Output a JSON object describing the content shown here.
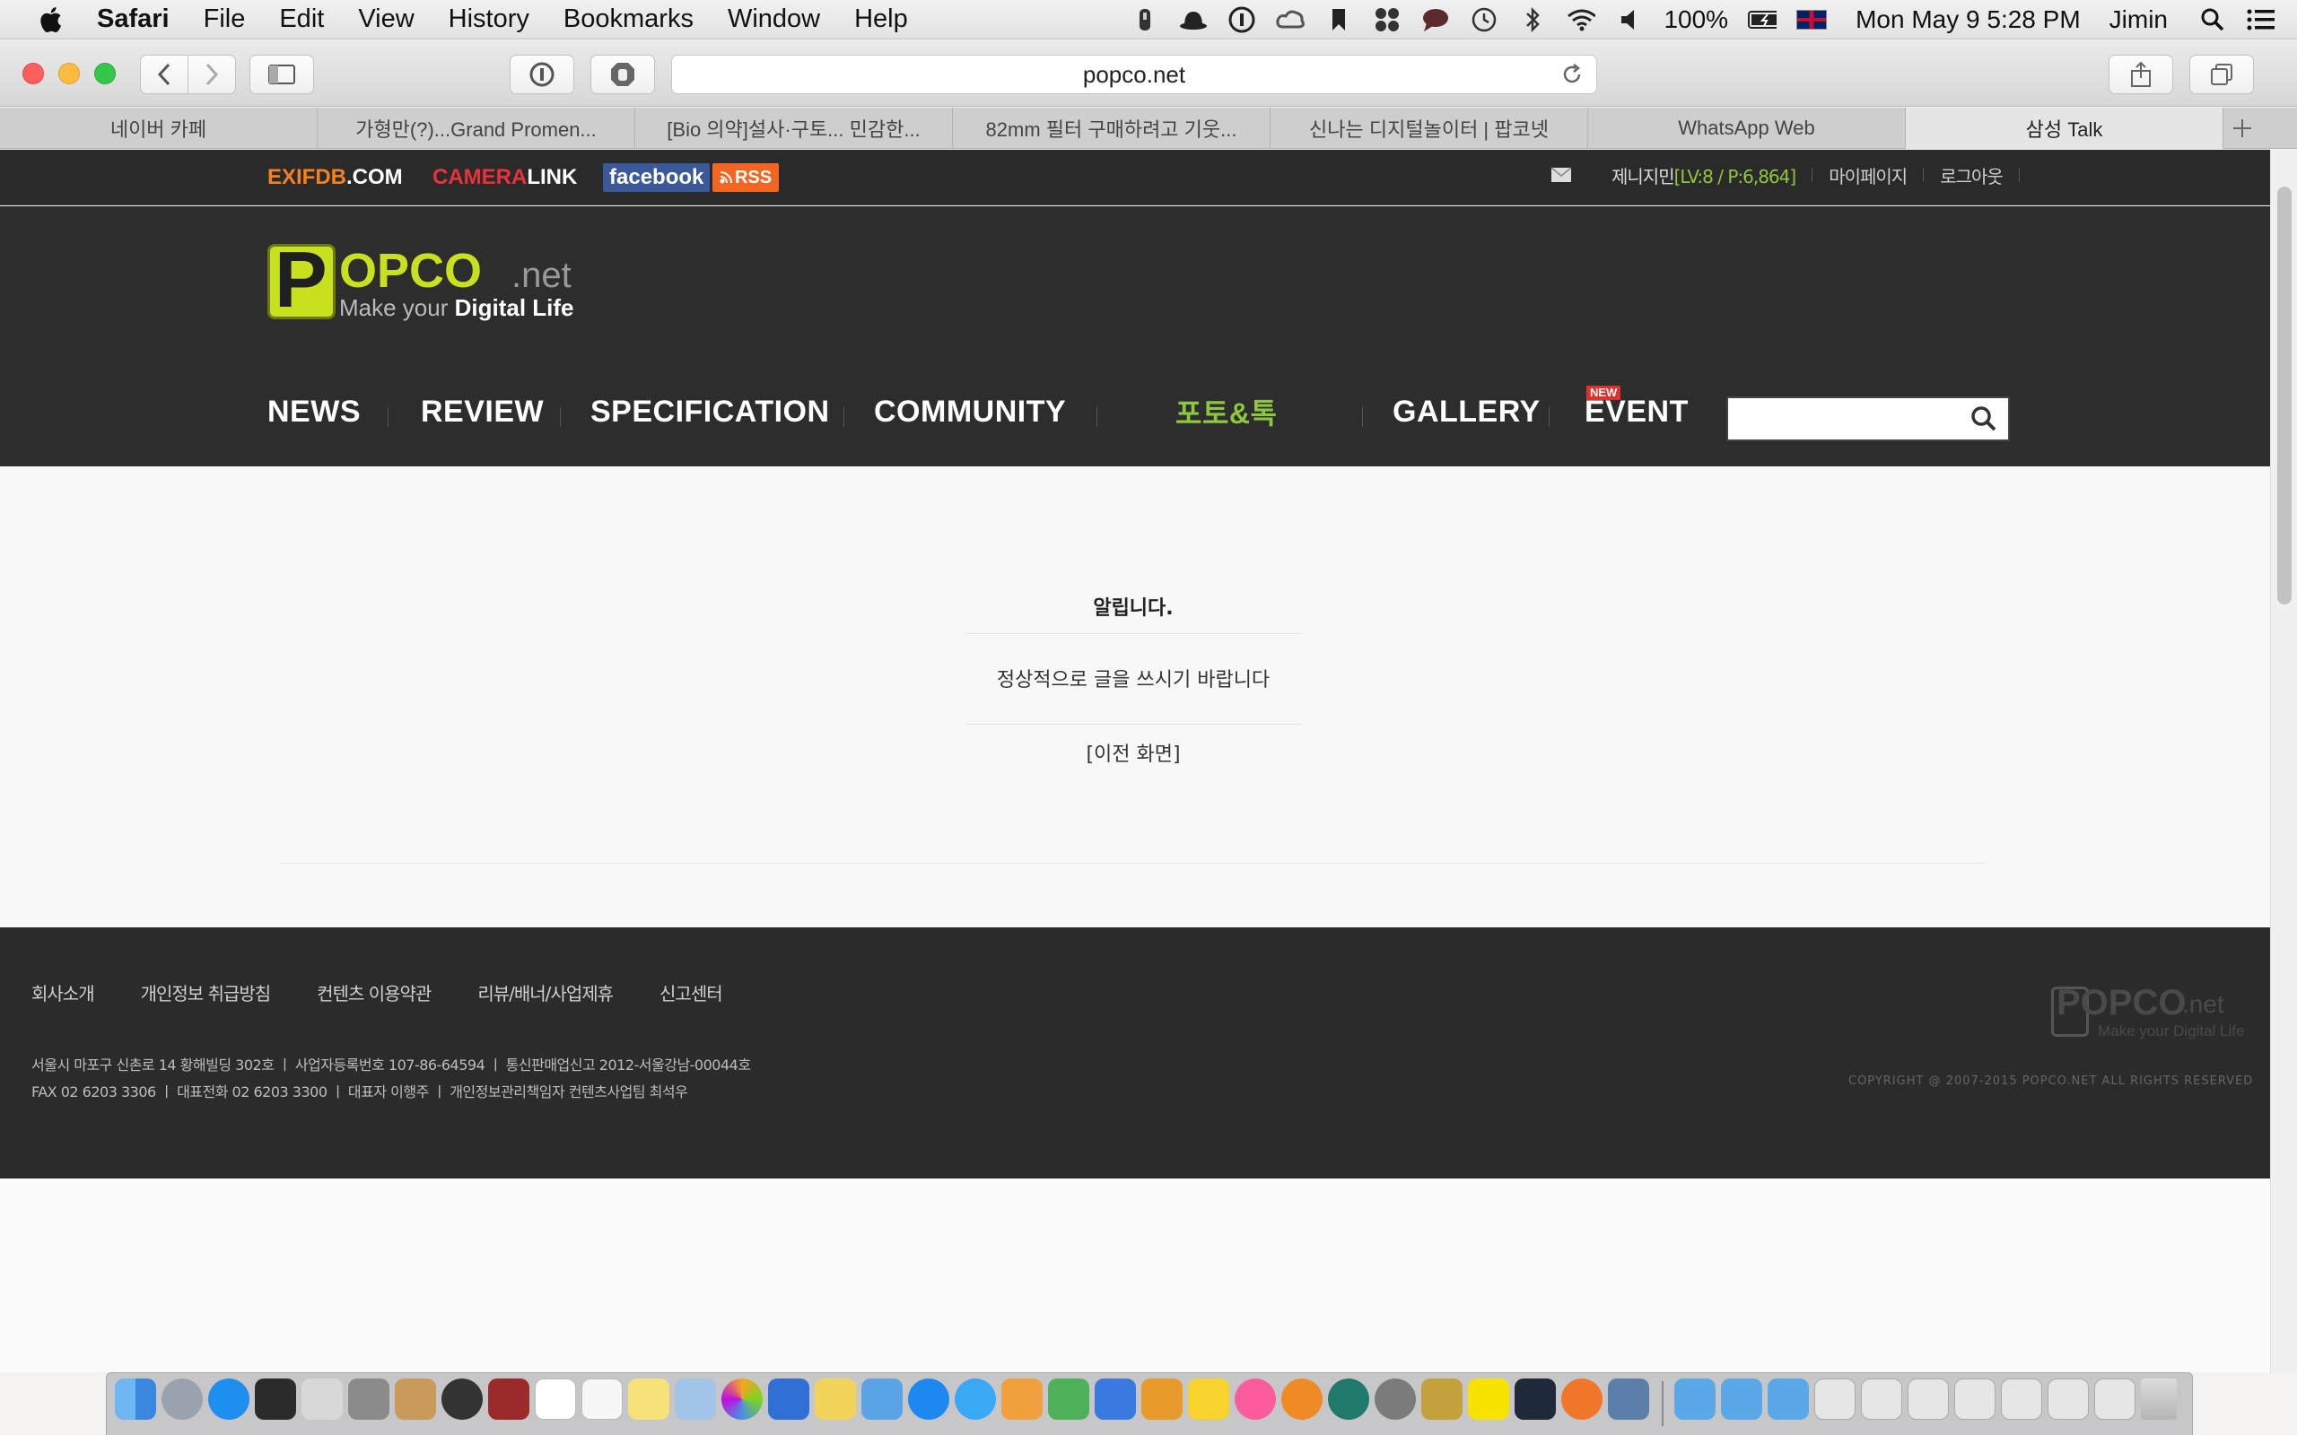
{
  "menubar": {
    "app_name": "Safari",
    "items": [
      "File",
      "Edit",
      "View",
      "History",
      "Bookmarks",
      "Window",
      "Help"
    ],
    "battery": "100%",
    "datetime": "Mon May 9  5:28 PM",
    "user": "Jimin"
  },
  "browser": {
    "url": "popco.net",
    "tabs": [
      "네이버 카페",
      "가형만(?)...Grand Promen...",
      "[Bio 의약]설사·구토... 민감한...",
      "82mm 필터 구매하려고 기웃...",
      "신나는 디지털놀이터 | 팝코넷",
      "WhatsApp Web",
      "삼성 Talk"
    ],
    "active_tab_index": 6
  },
  "site": {
    "partners": {
      "exifdb_a": "EXIFDB",
      "exifdb_b": ".COM",
      "cameralink_a": "CAMERA",
      "cameralink_b": "LINK",
      "facebook": "facebook",
      "rss": "RSS"
    },
    "user_links": {
      "nickname": "제니지민",
      "level": "[LV:8 / P:6,864]",
      "mypage": "마이페이지",
      "logout": "로그아웃"
    },
    "logo": {
      "brand_p": "P",
      "brand_rest": "OPCO",
      "brand_suffix": ".net",
      "tagline_a": "Make your ",
      "tagline_b": "Digital Life"
    },
    "nav": {
      "news": "NEWS",
      "review": "REVIEW",
      "specification": "SPECIFICATION",
      "community": "COMMUNITY",
      "photo_talk": "포토&톡",
      "gallery": "GALLERY",
      "event": "EVENT",
      "event_badge": "NEW"
    },
    "notice": {
      "title": "알립니다.",
      "message": "정상적으로 글을 쓰시기 바랍니다",
      "back_link": "[이전 화면]"
    },
    "footer": {
      "links": [
        "회사소개",
        "개인정보 취급방침",
        "컨텐츠 이용약관",
        "리뷰/배너/사업제휴",
        "신고센터"
      ],
      "info_line1": "서울시 마포구 신촌로 14 황해빌딩 302호   ㅣ   사업자등록번호 107-86-64594   ㅣ   통신판매업신고 2012-서울강남-00044호",
      "info_line2": "FAX 02 6203 3306   ㅣ   대표전화 02 6203 3300   ㅣ   대표자 이행주   ㅣ   개인정보관리책임자 컨텐츠사업팀 최석우",
      "copyright": "COPYRIGHT @ 2007-2015 POPCO.NET ALL RIGHTS RESERVED",
      "logo_text": "POPCO",
      "logo_suffix": ".net",
      "logo_tagline": "Make your Digital Life"
    }
  },
  "colors": {
    "accent_green": "#8dc63f",
    "exif_orange": "#f5821f",
    "cameralink_red": "#e8333c",
    "facebook_blue": "#3b5998",
    "rss_orange": "#f26522",
    "event_badge_red": "#e0302b"
  }
}
